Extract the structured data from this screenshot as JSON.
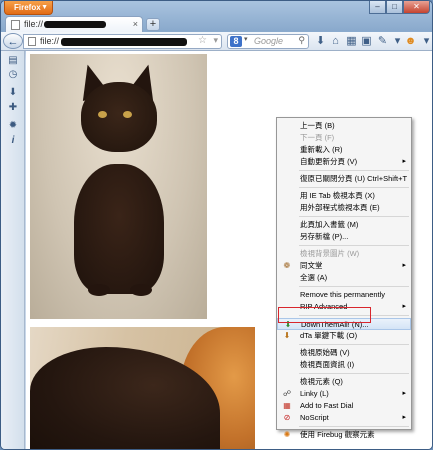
{
  "window": {
    "app_button": "Firefox",
    "controls": [
      "–",
      "□",
      "✕"
    ]
  },
  "tab": {
    "title_prefix": "file://",
    "close": "×"
  },
  "newtab": "+",
  "nav": {
    "url_prefix": "file://",
    "search_placeholder": "Google",
    "search_engine": "8"
  },
  "context_menu": {
    "items": [
      {
        "label": "上一頁 (B)",
        "disabled": false
      },
      {
        "label": "下一頁 (F)",
        "disabled": true
      },
      {
        "label": "重新載入 (R)",
        "disabled": false
      },
      {
        "label": "自動更新分頁 (V)",
        "disabled": false,
        "submenu": true
      },
      {
        "sep": true
      },
      {
        "label": "復原已關閉分頁 (U)   Ctrl+Shift+T",
        "disabled": false
      },
      {
        "sep": true
      },
      {
        "label": "用 IE Tab 檢視本頁 (X)",
        "disabled": false
      },
      {
        "label": "用外部程式檢視本頁 (E)",
        "disabled": false
      },
      {
        "sep": true
      },
      {
        "label": "此頁加入書籤 (M)",
        "disabled": false
      },
      {
        "label": "另存新檔 (P)...",
        "disabled": false
      },
      {
        "sep": true
      },
      {
        "label": "檢視背景圖片 (W)",
        "disabled": true
      },
      {
        "label": "同文堂",
        "disabled": false,
        "submenu": true,
        "icon": "tongwentang-icon"
      },
      {
        "label": "全選 (A)",
        "disabled": false
      },
      {
        "sep": true
      },
      {
        "label": "Remove this permanently",
        "disabled": false
      },
      {
        "label": "RIP Advanced",
        "disabled": false,
        "submenu": true
      },
      {
        "sep": true
      },
      {
        "label": "DownThemAll! (N)...",
        "disabled": false,
        "highlight": true,
        "icon": "downthemall-icon"
      },
      {
        "label": "dTa 單鍵下載 (O)",
        "disabled": false,
        "icon": "dta-onelick-icon"
      },
      {
        "sep": true
      },
      {
        "label": "檢視原始碼 (V)",
        "disabled": false
      },
      {
        "label": "檢視頁面資訊 (I)",
        "disabled": false
      },
      {
        "sep": true
      },
      {
        "label": "檢視元素 (Q)",
        "disabled": false
      },
      {
        "label": "Linky (L)",
        "disabled": false,
        "submenu": true,
        "icon": "linky-icon"
      },
      {
        "label": "Add to Fast Dial",
        "disabled": false,
        "icon": "fastdial-icon"
      },
      {
        "label": "NoScript",
        "disabled": false,
        "submenu": true,
        "icon": "noscript-icon"
      },
      {
        "sep": true
      },
      {
        "label": "使用 Firebug 觀察元素",
        "disabled": false,
        "icon": "firebug-icon"
      }
    ]
  }
}
